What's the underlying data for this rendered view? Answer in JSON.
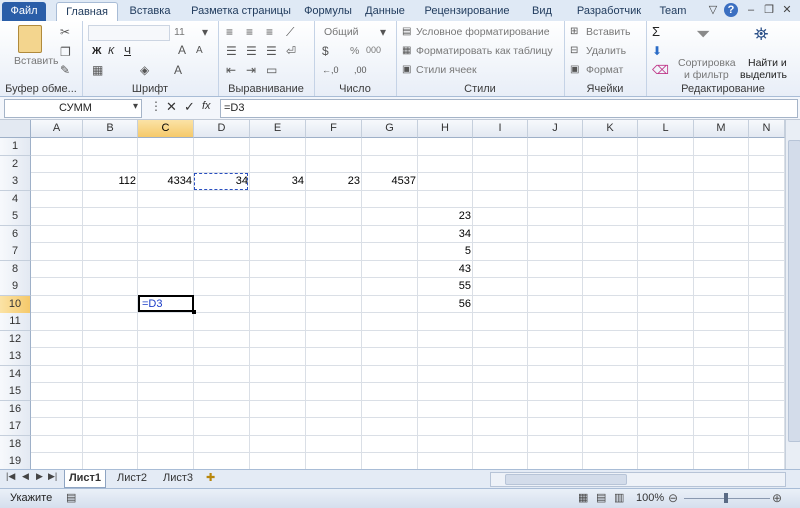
{
  "tabs": {
    "file": "Файл",
    "home": "Главная",
    "insert": "Вставка",
    "page_layout": "Разметка страницы",
    "formulas": "Формулы",
    "data": "Данные",
    "review": "Рецензирование",
    "view": "Вид",
    "developer": "Разработчик",
    "team": "Team"
  },
  "ribbon": {
    "clipboard": {
      "label": "Буфер обме...",
      "paste": "Вставить"
    },
    "font": {
      "label": "Шрифт",
      "size": "11",
      "bold": "Ж",
      "italic": "К",
      "underline": "Ч"
    },
    "alignment": {
      "label": "Выравнивание"
    },
    "number": {
      "label": "Число",
      "format": "Общий",
      "percent": "%",
      "thousands": "000"
    },
    "styles": {
      "label": "Стили",
      "conditional": "Условное форматирование",
      "as_table": "Форматировать как таблицу",
      "cell_styles": "Стили ячеек"
    },
    "cells": {
      "label": "Ячейки",
      "insert": "Вставить",
      "delete": "Удалить",
      "format": "Формат"
    },
    "editing": {
      "label": "Редактирование",
      "sort": "Сортировка",
      "sort2": "и фильтр",
      "find": "Найти и",
      "find2": "выделить"
    }
  },
  "formula_bar": {
    "name_box": "СУММ",
    "fx": "fx",
    "formula": "=D3"
  },
  "columns": [
    "A",
    "B",
    "C",
    "D",
    "E",
    "F",
    "G",
    "H",
    "I",
    "J",
    "K",
    "L",
    "M",
    "N"
  ],
  "rows": [
    "1",
    "2",
    "3",
    "4",
    "5",
    "6",
    "7",
    "8",
    "9",
    "10",
    "11",
    "12",
    "13",
    "14",
    "15",
    "16",
    "17",
    "18",
    "19"
  ],
  "cells": {
    "B3": "112",
    "C3": "4334",
    "D3": "34",
    "E3": "34",
    "F3": "23",
    "G3": "4537",
    "H5": "23",
    "H6": "34",
    "H7": "5",
    "H8": "43",
    "H9": "55",
    "H10": "56",
    "C10": "=D3"
  },
  "sheets": [
    "Лист1",
    "Лист2",
    "Лист3"
  ],
  "status": {
    "mode": "Укажите",
    "zoom": "100%"
  },
  "colors": {
    "file_tab": "#2a5ea8",
    "selection_header": "#f5c96a",
    "formula_ref": "#1a3cc7"
  }
}
